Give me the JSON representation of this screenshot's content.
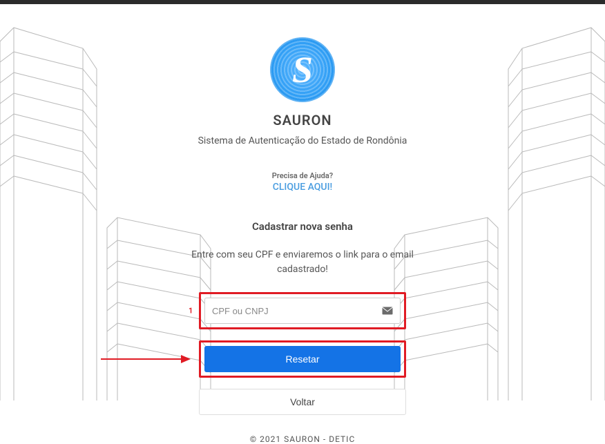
{
  "app": {
    "title": "SAURON",
    "subtitle": "Sistema de Autenticação do Estado de Rondônia"
  },
  "help": {
    "label": "Precisa de Ajuda?",
    "link_text": "CLIQUE AQUI!"
  },
  "form": {
    "section_title": "Cadastrar nova senha",
    "instructions": "Entre com seu CPF e enviaremos o link para o email cadastrado!",
    "cpf_placeholder": "CPF ou CNPJ",
    "cpf_value": "",
    "reset_label": "Resetar",
    "back_label": "Voltar"
  },
  "annotations": {
    "input_marker": "1"
  },
  "footer": {
    "text": "©   2021   SAURON -   DETIC"
  }
}
